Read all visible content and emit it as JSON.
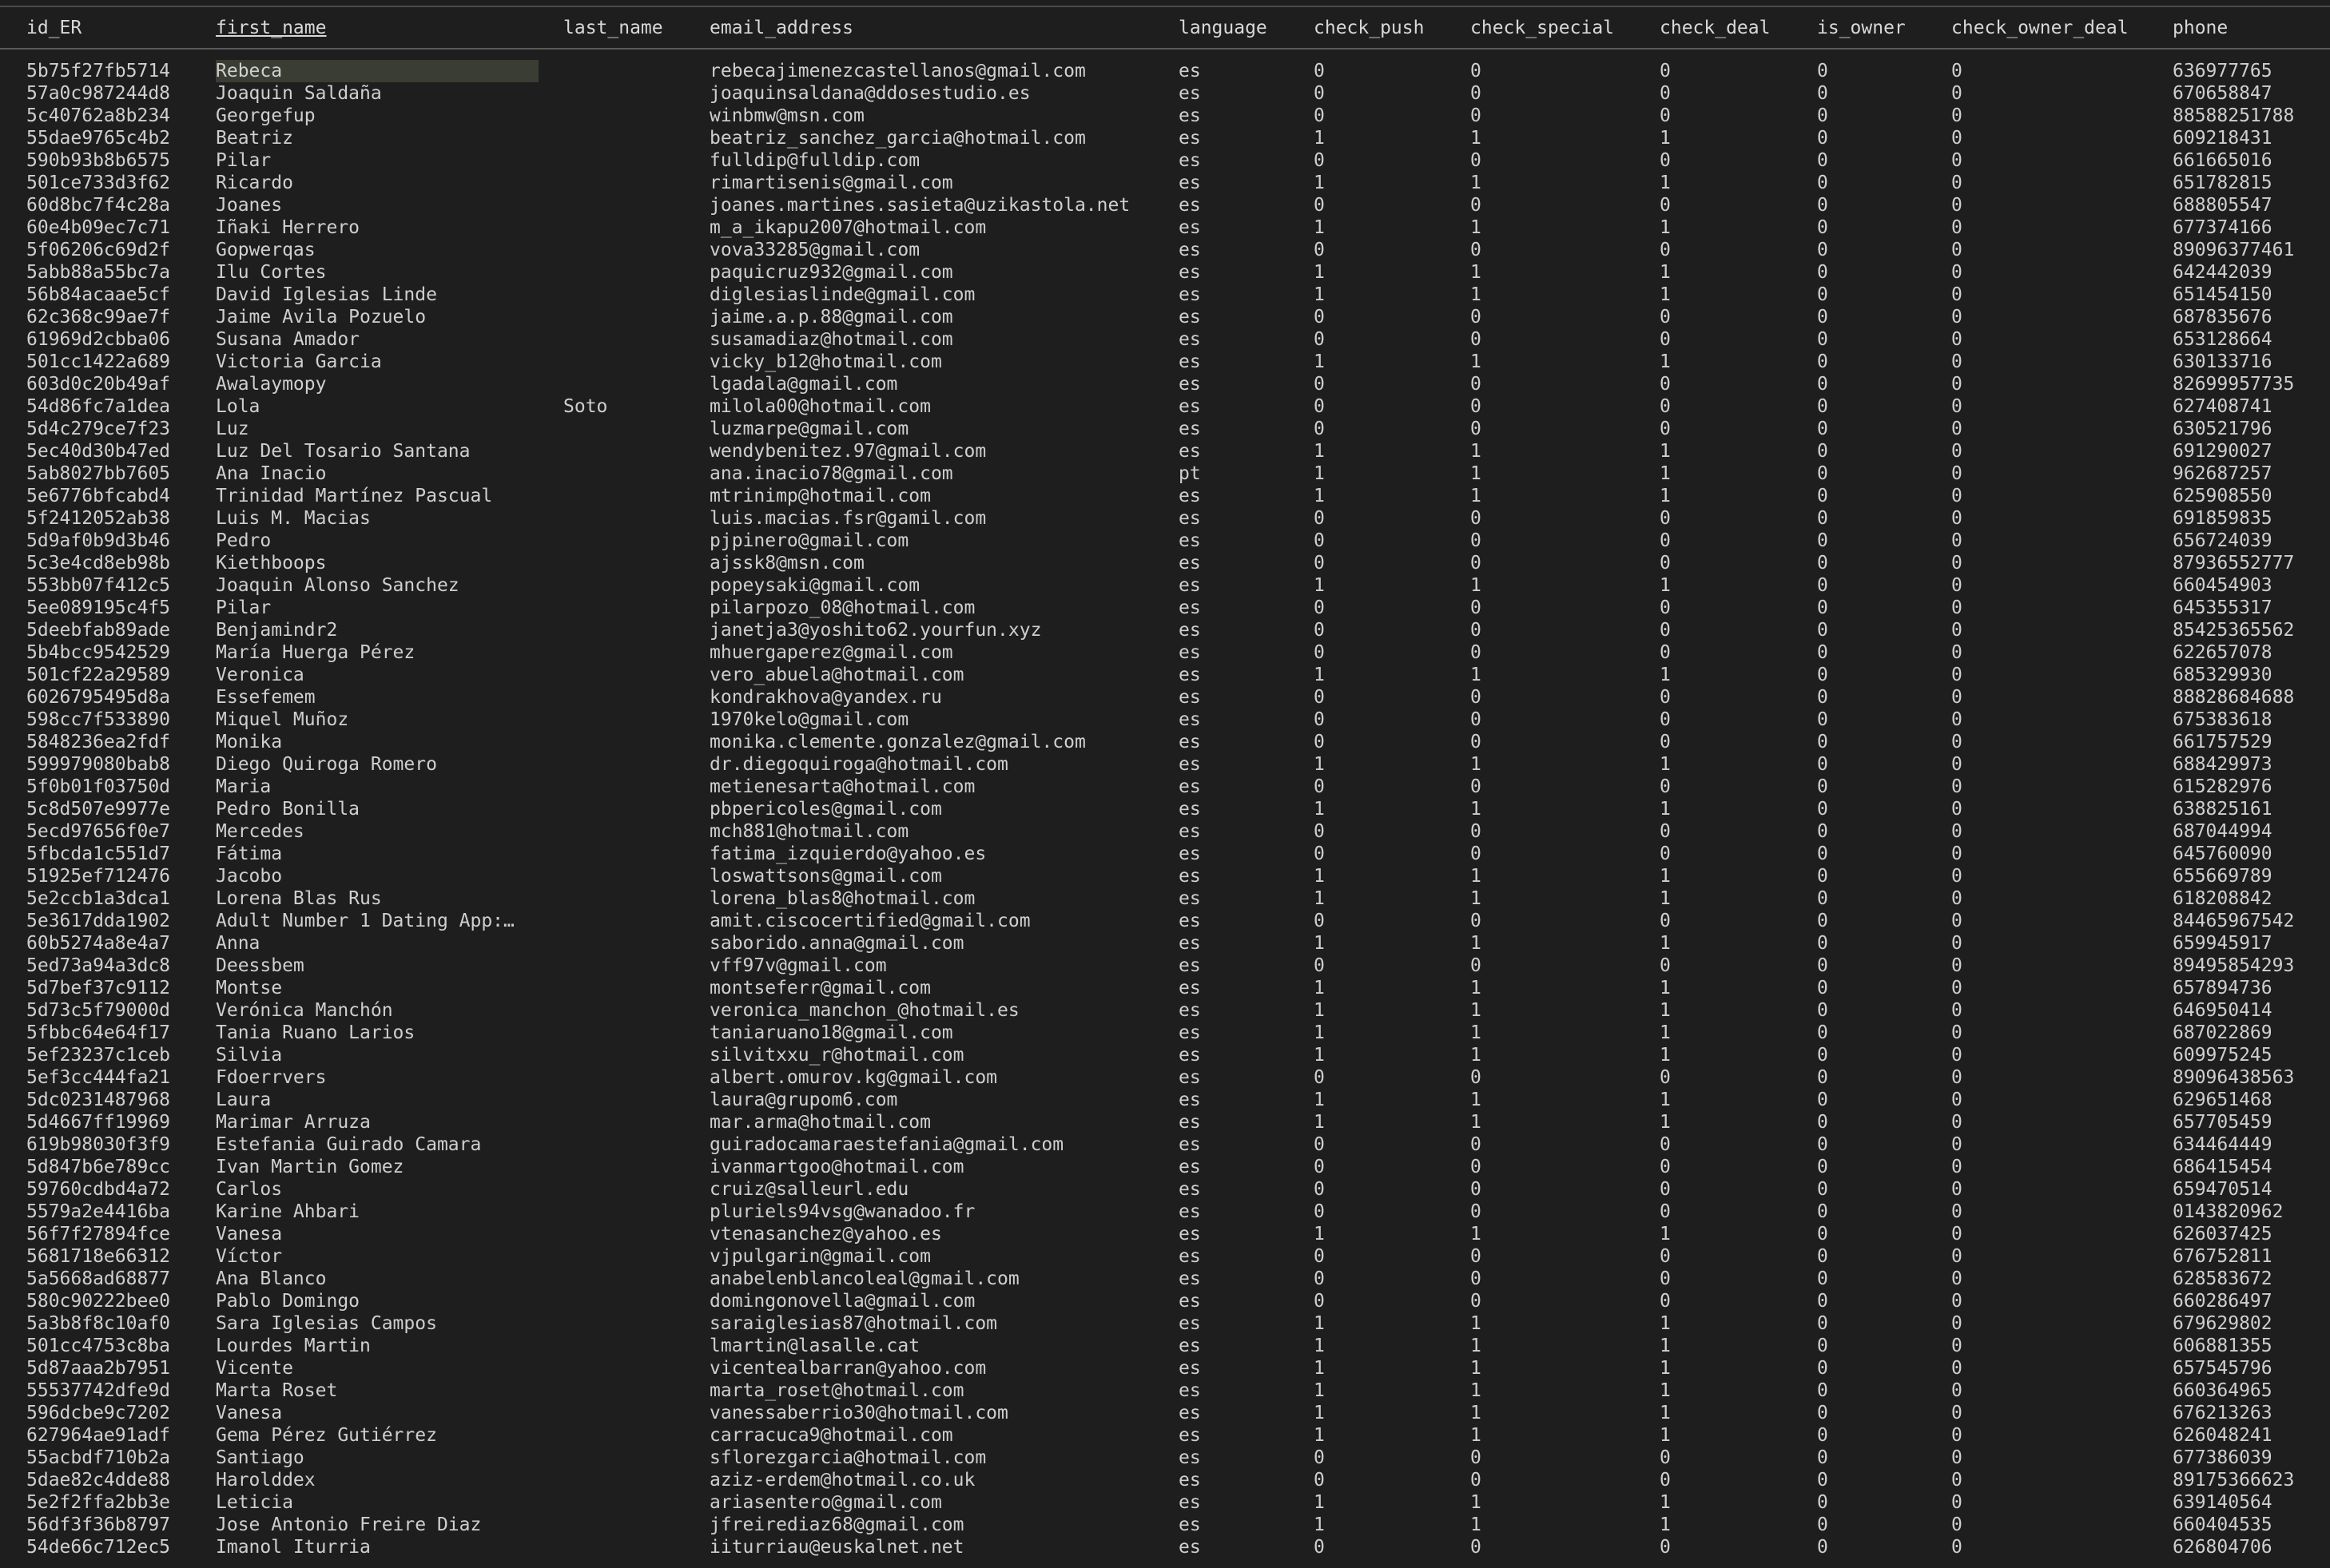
{
  "columns": [
    "id_ER",
    "first_name",
    "last_name",
    "email_address",
    "language",
    "check_push",
    "check_special",
    "check_deal",
    "is_owner",
    "check_owner_deal",
    "phone"
  ],
  "sorted_column": 1,
  "selected_cell": {
    "row": 0,
    "col": 1
  },
  "rows": [
    [
      "5b75f27fb5714",
      "Rebeca",
      "",
      "rebecajimenezcastellanos@gmail.com",
      "es",
      "0",
      "0",
      "0",
      "0",
      "0",
      "636977765"
    ],
    [
      "57a0c987244d8",
      "Joaquin Saldaña",
      "",
      "joaquinsaldana@ddosestudio.es",
      "es",
      "0",
      "0",
      "0",
      "0",
      "0",
      "670658847"
    ],
    [
      "5c40762a8b234",
      "Georgefup",
      "",
      "winbmw@msn.com",
      "es",
      "0",
      "0",
      "0",
      "0",
      "0",
      "88588251788"
    ],
    [
      "55dae9765c4b2",
      "Beatriz",
      "",
      "beatriz_sanchez_garcia@hotmail.com",
      "es",
      "1",
      "1",
      "1",
      "0",
      "0",
      "609218431"
    ],
    [
      "590b93b8b6575",
      "Pilar",
      "",
      "fulldip@fulldip.com",
      "es",
      "0",
      "0",
      "0",
      "0",
      "0",
      "661665016"
    ],
    [
      "501ce733d3f62",
      "Ricardo",
      "",
      "rimartisenis@gmail.com",
      "es",
      "1",
      "1",
      "1",
      "0",
      "0",
      "651782815"
    ],
    [
      "60d8bc7f4c28a",
      "Joanes",
      "",
      "joanes.martines.sasieta@uzikastola.net",
      "es",
      "0",
      "0",
      "0",
      "0",
      "0",
      "688805547"
    ],
    [
      "60e4b09ec7c71",
      "Iñaki Herrero",
      "",
      "m_a_ikapu2007@hotmail.com",
      "es",
      "1",
      "1",
      "1",
      "0",
      "0",
      "677374166"
    ],
    [
      "5f06206c69d2f",
      "Gopwerqas",
      "",
      "vova33285@gmail.com",
      "es",
      "0",
      "0",
      "0",
      "0",
      "0",
      "89096377461"
    ],
    [
      "5abb88a55bc7a",
      "Ilu Cortes",
      "",
      "paquicruz932@gmail.com",
      "es",
      "1",
      "1",
      "1",
      "0",
      "0",
      "642442039"
    ],
    [
      "56b84acaae5cf",
      "David Iglesias Linde",
      "",
      "diglesiaslinde@gmail.com",
      "es",
      "1",
      "1",
      "1",
      "0",
      "0",
      "651454150"
    ],
    [
      "62c368c99ae7f",
      "Jaime Avila Pozuelo",
      "",
      "jaime.a.p.88@gmail.com",
      "es",
      "0",
      "0",
      "0",
      "0",
      "0",
      "687835676"
    ],
    [
      "61969d2cbba06",
      "Susana Amador",
      "",
      "susamadiaz@hotmail.com",
      "es",
      "0",
      "0",
      "0",
      "0",
      "0",
      "653128664"
    ],
    [
      "501cc1422a689",
      "Victoria Garcia",
      "",
      "vicky_b12@hotmail.com",
      "es",
      "1",
      "1",
      "1",
      "0",
      "0",
      "630133716"
    ],
    [
      "603d0c20b49af",
      "Awalaymopy",
      "",
      "lgadala@gmail.com",
      "es",
      "0",
      "0",
      "0",
      "0",
      "0",
      "82699957735"
    ],
    [
      "54d86fc7a1dea",
      "Lola",
      "Soto",
      "milola00@hotmail.com",
      "es",
      "0",
      "0",
      "0",
      "0",
      "0",
      "627408741"
    ],
    [
      "5d4c279ce7f23",
      "Luz",
      "",
      "luzmarpe@gmail.com",
      "es",
      "0",
      "0",
      "0",
      "0",
      "0",
      "630521796"
    ],
    [
      "5ec40d30b47ed",
      "Luz Del Tosario Santana",
      "",
      "wendybenitez.97@gmail.com",
      "es",
      "1",
      "1",
      "1",
      "0",
      "0",
      "691290027"
    ],
    [
      "5ab8027bb7605",
      "Ana Inacio",
      "",
      "ana.inacio78@gmail.com",
      "pt",
      "1",
      "1",
      "1",
      "0",
      "0",
      "962687257"
    ],
    [
      "5e6776bfcabd4",
      "Trinidad Martínez Pascual",
      "",
      "mtrinimp@hotmail.com",
      "es",
      "1",
      "1",
      "1",
      "0",
      "0",
      "625908550"
    ],
    [
      "5f2412052ab38",
      "Luis M. Macias",
      "",
      "luis.macias.fsr@gamil.com",
      "es",
      "0",
      "0",
      "0",
      "0",
      "0",
      "691859835"
    ],
    [
      "5d9af0b9d3b46",
      "Pedro",
      "",
      "pjpinero@gmail.com",
      "es",
      "0",
      "0",
      "0",
      "0",
      "0",
      "656724039"
    ],
    [
      "5c3e4cd8eb98b",
      "Kiethboops",
      "",
      "ajssk8@msn.com",
      "es",
      "0",
      "0",
      "0",
      "0",
      "0",
      "87936552777"
    ],
    [
      "553bb07f412c5",
      "Joaquin Alonso Sanchez",
      "",
      "popeysaki@gmail.com",
      "es",
      "1",
      "1",
      "1",
      "0",
      "0",
      "660454903"
    ],
    [
      "5ee089195c4f5",
      "Pilar",
      "",
      "pilarpozo_08@hotmail.com",
      "es",
      "0",
      "0",
      "0",
      "0",
      "0",
      "645355317"
    ],
    [
      "5deebfab89ade",
      "Benjamindr2",
      "",
      "janetja3@yoshito62.yourfun.xyz",
      "es",
      "0",
      "0",
      "0",
      "0",
      "0",
      "85425365562"
    ],
    [
      "5b4bcc9542529",
      "María Huerga Pérez",
      "",
      "mhuergaperez@gmail.com",
      "es",
      "0",
      "0",
      "0",
      "0",
      "0",
      "622657078"
    ],
    [
      "501cf22a29589",
      "Veronica",
      "",
      "vero_abuela@hotmail.com",
      "es",
      "1",
      "1",
      "1",
      "0",
      "0",
      "685329930"
    ],
    [
      "6026795495d8a",
      "Essefemem",
      "",
      "kondrakhova@yandex.ru",
      "es",
      "0",
      "0",
      "0",
      "0",
      "0",
      "88828684688"
    ],
    [
      "598cc7f533890",
      "Miquel Muñoz",
      "",
      "1970kelo@gmail.com",
      "es",
      "0",
      "0",
      "0",
      "0",
      "0",
      "675383618"
    ],
    [
      "5848236ea2fdf",
      "Monika",
      "",
      "monika.clemente.gonzalez@gmail.com",
      "es",
      "0",
      "0",
      "0",
      "0",
      "0",
      "661757529"
    ],
    [
      "599979080bab8",
      "Diego Quiroga Romero",
      "",
      "dr.diegoquiroga@hotmail.com",
      "es",
      "1",
      "1",
      "1",
      "0",
      "0",
      "688429973"
    ],
    [
      "5f0b01f03750d",
      "Maria",
      "",
      "metienesarta@hotmail.com",
      "es",
      "0",
      "0",
      "0",
      "0",
      "0",
      "615282976"
    ],
    [
      "5c8d507e9977e",
      "Pedro Bonilla",
      "",
      "pbpericoles@gmail.com",
      "es",
      "1",
      "1",
      "1",
      "0",
      "0",
      "638825161"
    ],
    [
      "5ecd97656f0e7",
      "Mercedes",
      "",
      "mch881@hotmail.com",
      "es",
      "0",
      "0",
      "0",
      "0",
      "0",
      "687044994"
    ],
    [
      "5fbcda1c551d7",
      "Fátima",
      "",
      "fatima_izquierdo@yahoo.es",
      "es",
      "0",
      "0",
      "0",
      "0",
      "0",
      "645760090"
    ],
    [
      "51925ef712476",
      "Jacobo",
      "",
      "loswattsons@gmail.com",
      "es",
      "1",
      "1",
      "1",
      "0",
      "0",
      "655669789"
    ],
    [
      "5e2ccb1a3dca1",
      "Lorena Blas Rus",
      "",
      "lorena_blas8@hotmail.com",
      "es",
      "1",
      "1",
      "1",
      "0",
      "0",
      "618208842"
    ],
    [
      "5e3617dda1902",
      "Adult Number 1 Dating App:…",
      "",
      "amit.ciscocertified@gmail.com",
      "es",
      "0",
      "0",
      "0",
      "0",
      "0",
      "84465967542"
    ],
    [
      "60b5274a8e4a7",
      "Anna",
      "",
      "saborido.anna@gmail.com",
      "es",
      "1",
      "1",
      "1",
      "0",
      "0",
      "659945917"
    ],
    [
      "5ed73a94a3dc8",
      "Deessbem",
      "",
      "vff97v@gmail.com",
      "es",
      "0",
      "0",
      "0",
      "0",
      "0",
      "89495854293"
    ],
    [
      "5d7bef37c9112",
      "Montse",
      "",
      "montseferr@gmail.com",
      "es",
      "1",
      "1",
      "1",
      "0",
      "0",
      "657894736"
    ],
    [
      "5d73c5f79000d",
      "Verónica Manchón",
      "",
      "veronica_manchon_@hotmail.es",
      "es",
      "1",
      "1",
      "1",
      "0",
      "0",
      "646950414"
    ],
    [
      "5fbbc64e64f17",
      "Tania Ruano Larios",
      "",
      "taniaruano18@gmail.com",
      "es",
      "1",
      "1",
      "1",
      "0",
      "0",
      "687022869"
    ],
    [
      "5ef23237c1ceb",
      "Silvia",
      "",
      "silvitxxu_r@hotmail.com",
      "es",
      "1",
      "1",
      "1",
      "0",
      "0",
      "609975245"
    ],
    [
      "5ef3cc444fa21",
      "Fdoerrvers",
      "",
      "albert.omurov.kg@gmail.com",
      "es",
      "0",
      "0",
      "0",
      "0",
      "0",
      "89096438563"
    ],
    [
      "5dc0231487968",
      "Laura",
      "",
      "laura@grupom6.com",
      "es",
      "1",
      "1",
      "1",
      "0",
      "0",
      "629651468"
    ],
    [
      "5d4667ff19969",
      "Marimar Arruza",
      "",
      "mar.arma@hotmail.com",
      "es",
      "1",
      "1",
      "1",
      "0",
      "0",
      "657705459"
    ],
    [
      "619b98030f3f9",
      "Estefania Guirado Camara",
      "",
      "guiradocamaraestefania@gmail.com",
      "es",
      "0",
      "0",
      "0",
      "0",
      "0",
      "634464449"
    ],
    [
      "5d847b6e789cc",
      "Ivan Martin Gomez",
      "",
      "ivanmartgoo@hotmail.com",
      "es",
      "0",
      "0",
      "0",
      "0",
      "0",
      "686415454"
    ],
    [
      "59760cdbd4a72",
      "Carlos",
      "",
      "cruiz@salleurl.edu",
      "es",
      "0",
      "0",
      "0",
      "0",
      "0",
      "659470514"
    ],
    [
      "5579a2e4416ba",
      "Karine Ahbari",
      "",
      "pluriels94vsg@wanadoo.fr",
      "es",
      "0",
      "0",
      "0",
      "0",
      "0",
      "0143820962"
    ],
    [
      "56f7f27894fce",
      "Vanesa",
      "",
      "vtenasanchez@yahoo.es",
      "es",
      "1",
      "1",
      "1",
      "0",
      "0",
      "626037425"
    ],
    [
      "5681718e66312",
      "Víctor",
      "",
      "vjpulgarin@gmail.com",
      "es",
      "0",
      "0",
      "0",
      "0",
      "0",
      "676752811"
    ],
    [
      "5a5668ad68877",
      "Ana Blanco",
      "",
      "anabelenblancoleal@gmail.com",
      "es",
      "0",
      "0",
      "0",
      "0",
      "0",
      "628583672"
    ],
    [
      "580c90222bee0",
      "Pablo Domingo",
      "",
      "domingonovella@gmail.com",
      "es",
      "0",
      "0",
      "0",
      "0",
      "0",
      "660286497"
    ],
    [
      "5a3b8f8c10af0",
      "Sara Iglesias Campos",
      "",
      "saraiglesias87@hotmail.com",
      "es",
      "1",
      "1",
      "1",
      "0",
      "0",
      "679629802"
    ],
    [
      "501cc4753c8ba",
      "Lourdes Martin",
      "",
      "lmartin@lasalle.cat",
      "es",
      "1",
      "1",
      "1",
      "0",
      "0",
      "606881355"
    ],
    [
      "5d87aaa2b7951",
      "Vicente",
      "",
      "vicentealbarran@yahoo.com",
      "es",
      "1",
      "1",
      "1",
      "0",
      "0",
      "657545796"
    ],
    [
      "55537742dfe9d",
      "Marta Roset",
      "",
      "marta_roset@hotmail.com",
      "es",
      "1",
      "1",
      "1",
      "0",
      "0",
      "660364965"
    ],
    [
      "596dcbe9c7202",
      "Vanesa",
      "",
      "vanessaberrio30@hotmail.com",
      "es",
      "1",
      "1",
      "1",
      "0",
      "0",
      "676213263"
    ],
    [
      "627964ae91adf",
      "Gema Pérez Gutiérrez",
      "",
      "carracuca9@hotmail.com",
      "es",
      "1",
      "1",
      "1",
      "0",
      "0",
      "626048241"
    ],
    [
      "55acbdf710b2a",
      "Santiago",
      "",
      "sflorezgarcia@hotmail.com",
      "es",
      "0",
      "0",
      "0",
      "0",
      "0",
      "677386039"
    ],
    [
      "5dae82c4dde88",
      "Harolddex",
      "",
      "aziz-erdem@hotmail.co.uk",
      "es",
      "0",
      "0",
      "0",
      "0",
      "0",
      "89175366623"
    ],
    [
      "5e2f2ffa2bb3e",
      "Leticia",
      "",
      "ariasentero@gmail.com",
      "es",
      "1",
      "1",
      "1",
      "0",
      "0",
      "639140564"
    ],
    [
      "56df3f36b8797",
      "Jose Antonio Freire Diaz",
      "",
      "jfreirediaz68@gmail.com",
      "es",
      "1",
      "1",
      "1",
      "0",
      "0",
      "660404535"
    ],
    [
      "54de66c712ec5",
      "Imanol Iturria",
      "",
      "iiturriau@euskalnet.net",
      "es",
      "0",
      "0",
      "0",
      "0",
      "0",
      "626804706"
    ]
  ]
}
